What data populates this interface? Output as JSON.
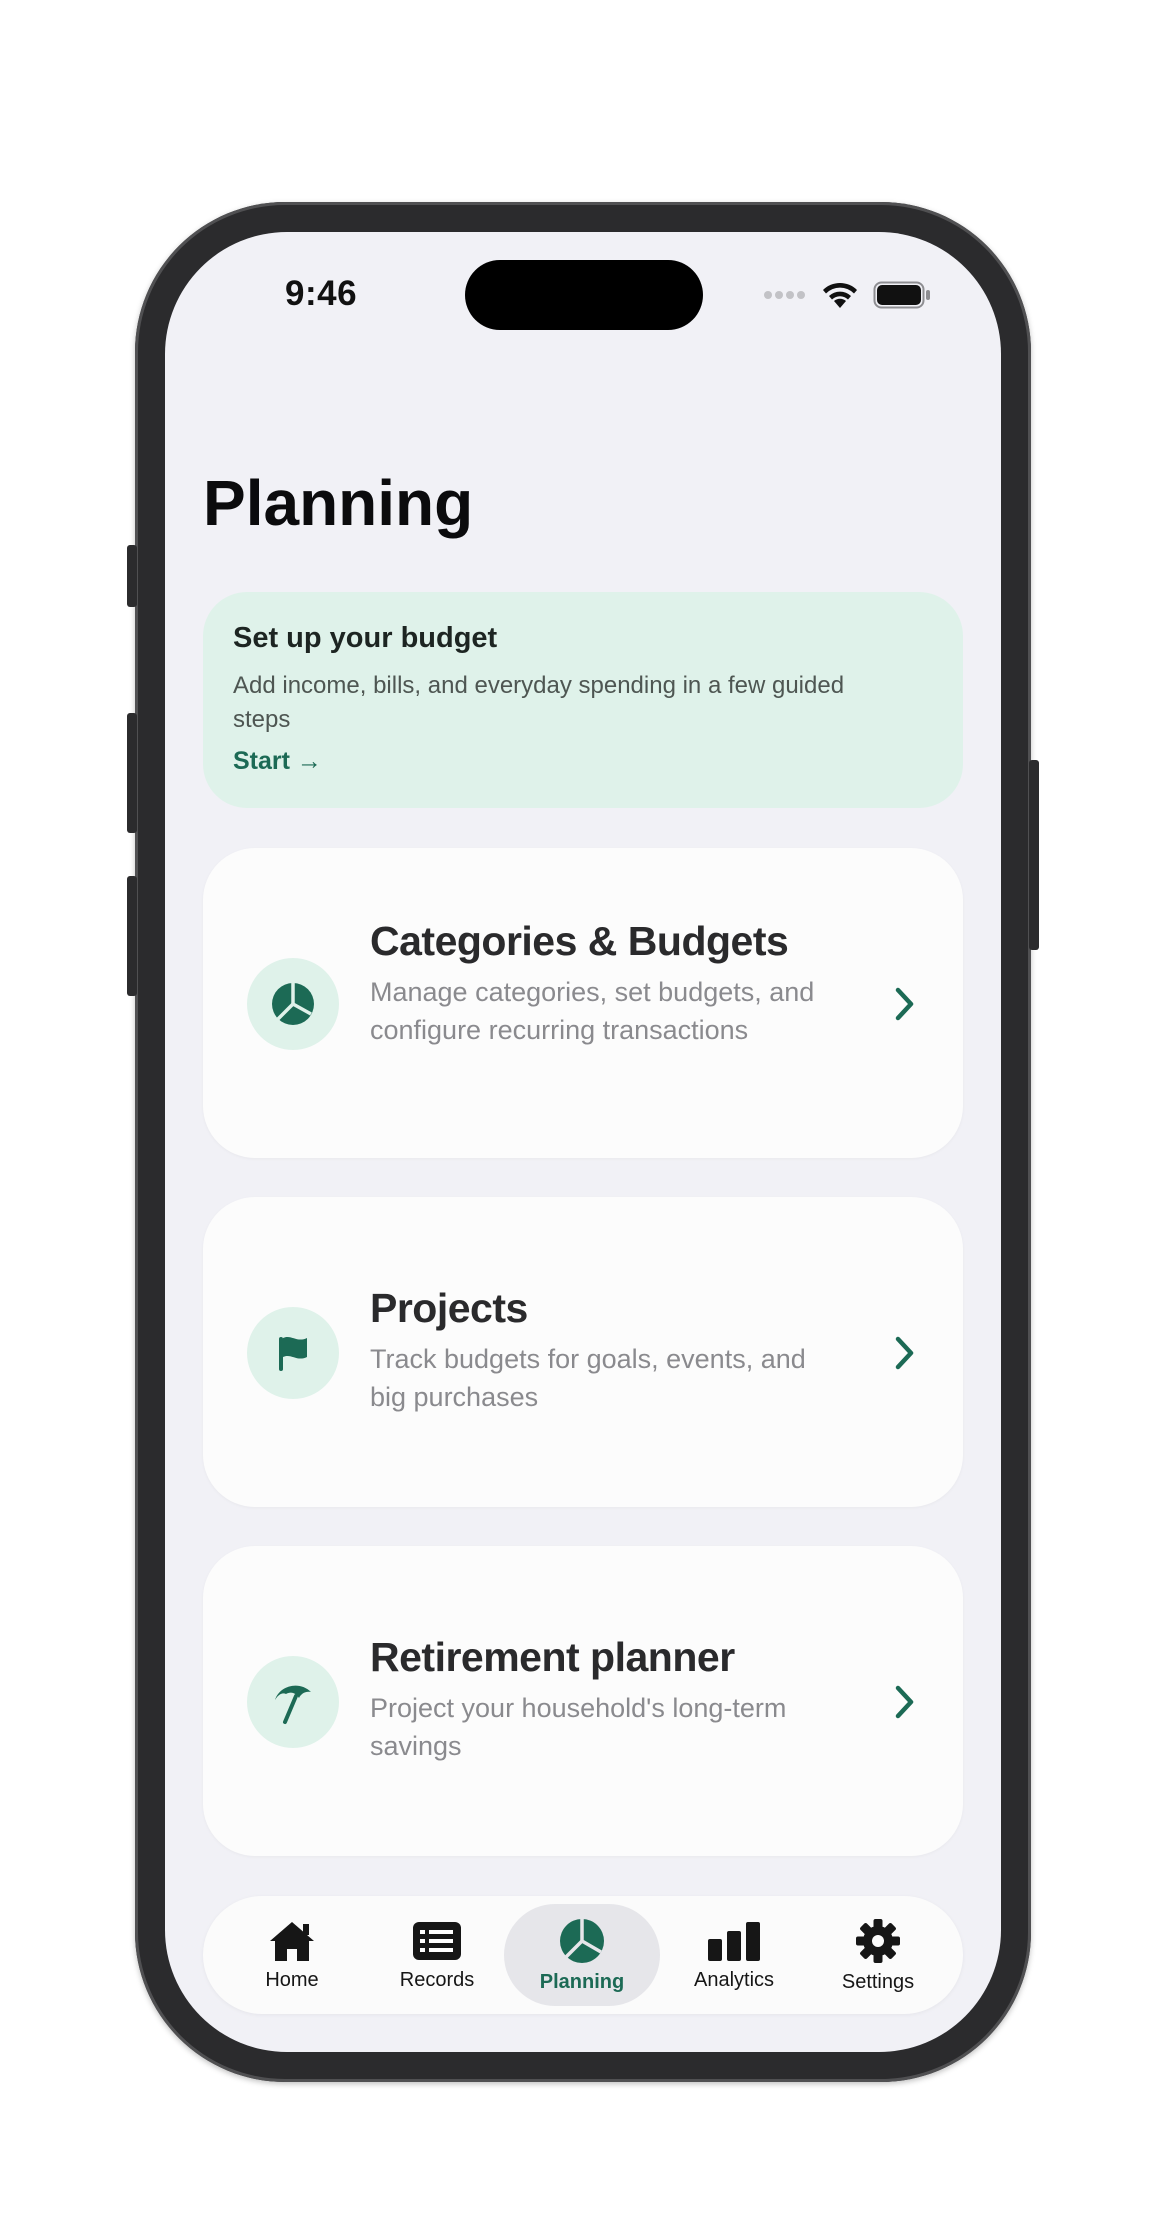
{
  "status_bar": {
    "time": "9:46"
  },
  "page": {
    "title": "Planning"
  },
  "banner": {
    "title": "Set up your budget",
    "text": "Add income, bills, and everyday spending in a few guided steps",
    "link": "Start →"
  },
  "cards": [
    {
      "title": "Categories & Budgets",
      "description": "Manage categories, set budgets, and configure recurring transactions",
      "icon": "pie-chart-icon"
    },
    {
      "title": "Projects",
      "description": "Track budgets for goals, events, and big purchases",
      "icon": "flag-icon"
    },
    {
      "title": "Retirement planner",
      "description": "Project your household's long-term savings",
      "icon": "beach-umbrella-icon"
    }
  ],
  "tabbar": {
    "tabs": [
      {
        "label": "Home",
        "icon": "house-icon"
      },
      {
        "label": "Records",
        "icon": "list-icon"
      },
      {
        "label": "Planning",
        "icon": "pie-chart-icon",
        "active": true
      },
      {
        "label": "Analytics",
        "icon": "bar-chart-icon"
      },
      {
        "label": "Settings",
        "icon": "gear-icon"
      }
    ]
  },
  "colors": {
    "accent": "#1c6a55",
    "accent_soft": "#dff2ea",
    "background": "#f1f1f6",
    "card": "#fcfcfc"
  }
}
